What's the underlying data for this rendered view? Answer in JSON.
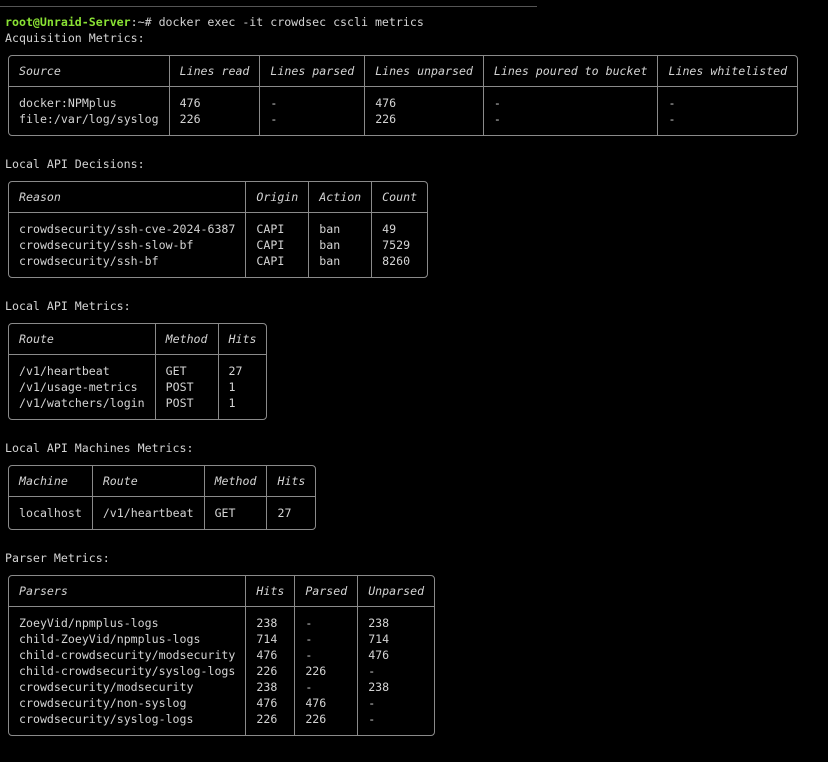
{
  "prompt": {
    "user_host": "root@Unraid-Server",
    "path": ":~# ",
    "command": "docker exec -it crowdsec cscli metrics"
  },
  "sections": [
    {
      "title": "Acquisition Metrics:",
      "headers": [
        "Source",
        "Lines read",
        "Lines parsed",
        "Lines unparsed",
        "Lines poured to bucket",
        "Lines whitelisted"
      ],
      "rows": [
        [
          "docker:NPMplus",
          "476",
          "-",
          "476",
          "-",
          "-"
        ],
        [
          "file:/var/log/syslog",
          "226",
          "-",
          "226",
          "-",
          "-"
        ]
      ]
    },
    {
      "title": "Local API Decisions:",
      "headers": [
        "Reason",
        "Origin",
        "Action",
        "Count"
      ],
      "rows": [
        [
          "crowdsecurity/ssh-cve-2024-6387",
          "CAPI",
          "ban",
          "49"
        ],
        [
          "crowdsecurity/ssh-slow-bf",
          "CAPI",
          "ban",
          "7529"
        ],
        [
          "crowdsecurity/ssh-bf",
          "CAPI",
          "ban",
          "8260"
        ]
      ]
    },
    {
      "title": "Local API Metrics:",
      "headers": [
        "Route",
        "Method",
        "Hits"
      ],
      "rows": [
        [
          "/v1/heartbeat",
          "GET",
          "27"
        ],
        [
          "/v1/usage-metrics",
          "POST",
          "1"
        ],
        [
          "/v1/watchers/login",
          "POST",
          "1"
        ]
      ]
    },
    {
      "title": "Local API Machines Metrics:",
      "headers": [
        "Machine",
        "Route",
        "Method",
        "Hits"
      ],
      "rows": [
        [
          "localhost",
          "/v1/heartbeat",
          "GET",
          "27"
        ]
      ]
    },
    {
      "title": "Parser Metrics:",
      "headers": [
        "Parsers",
        "Hits",
        "Parsed",
        "Unparsed"
      ],
      "rows": [
        [
          "ZoeyVid/npmplus-logs",
          "238",
          "-",
          "238"
        ],
        [
          "child-ZoeyVid/npmplus-logs",
          "714",
          "-",
          "714"
        ],
        [
          "child-crowdsecurity/modsecurity",
          "476",
          "-",
          "476"
        ],
        [
          "child-crowdsecurity/syslog-logs",
          "226",
          "226",
          "-"
        ],
        [
          "crowdsecurity/modsecurity",
          "238",
          "-",
          "238"
        ],
        [
          "crowdsecurity/non-syslog",
          "476",
          "476",
          "-"
        ],
        [
          "crowdsecurity/syslog-logs",
          "226",
          "226",
          "-"
        ]
      ]
    }
  ]
}
